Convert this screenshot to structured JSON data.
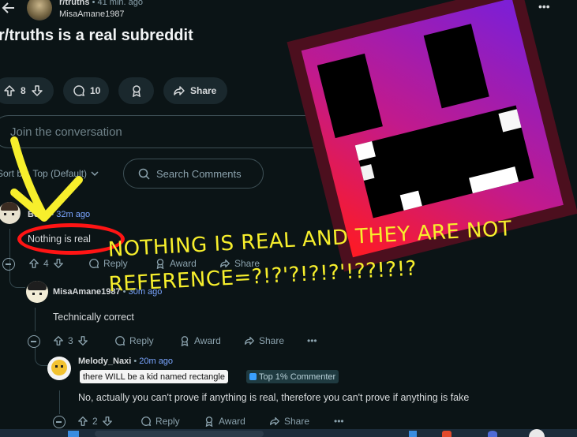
{
  "header": {
    "subreddit": "r/truths",
    "time": "41 min. ago",
    "author": "MisaAmane1987",
    "more_label": "•••"
  },
  "post": {
    "title": "r/truths is a real subreddit",
    "votes": "8",
    "comments": "10",
    "share_label": "Share"
  },
  "composer": {
    "placeholder": "Join the conversation"
  },
  "sort": {
    "label": "Sort by:",
    "value": "Top (Default)",
    "search_label": "Search Comments"
  },
  "comments": [
    {
      "username": "Benz",
      "time": "32m ago",
      "text": "Nothing is real",
      "votes": "4",
      "reply_label": "Reply",
      "award_label": "Award",
      "share_label": "Share"
    },
    {
      "username": "MisaAmane1987",
      "time": "30m ago",
      "text": "Technically correct",
      "votes": "3",
      "reply_label": "Reply",
      "award_label": "Award",
      "share_label": "Share",
      "more_label": "•••"
    },
    {
      "username": "Melody_Naxi",
      "time": "20m ago",
      "flair": "there WILL be a kid named rectangle",
      "badge": "Top 1% Commenter",
      "text": "No, actually you can't prove if anything is real, therefore you can't prove if anything is fake",
      "votes": "2",
      "reply_label": "Reply",
      "award_label": "Award",
      "share_label": "Share",
      "more_label": "•••"
    }
  ],
  "overlay": {
    "line1": "NOTHING IS REAL AND THEY ARE NOT",
    "line2": "REFERENCE=?!?'?!?!?'!??!?!?"
  },
  "colors": {
    "background": "#0b1416",
    "pill": "#1a282d",
    "link_blue": "#7aa5ff",
    "overlay_yellow": "#f7ef2c",
    "annotation_red": "#ff1414"
  }
}
